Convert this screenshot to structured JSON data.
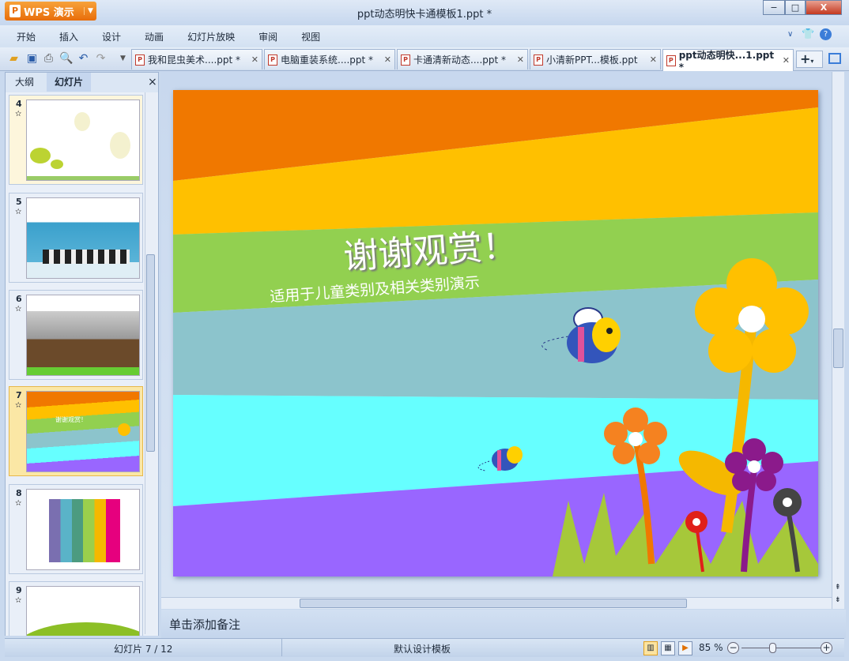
{
  "app": {
    "button_label": "WPS 演示",
    "window_title": "ppt动态明快卡通模板1.ppt *"
  },
  "window_controls": {
    "minimize": "−",
    "maximize": "□",
    "close": "X"
  },
  "menu": [
    "开始",
    "插入",
    "设计",
    "动画",
    "幻灯片放映",
    "审阅",
    "视图"
  ],
  "doc_tabs": [
    {
      "label": "我和昆虫美术....ppt *",
      "active": false
    },
    {
      "label": "电脑重装系统....ppt *",
      "active": false
    },
    {
      "label": "卡通清新动态....ppt *",
      "active": false
    },
    {
      "label": "小清新PPT...模板.ppt",
      "active": false
    },
    {
      "label": "ppt动态明快...1.ppt *",
      "active": true
    }
  ],
  "panel": {
    "tabs": [
      "大纲",
      "幻灯片"
    ],
    "active_tab": "幻灯片",
    "close": "×"
  },
  "thumbnails": [
    {
      "num": "4"
    },
    {
      "num": "5"
    },
    {
      "num": "6"
    },
    {
      "num": "7",
      "selected": true
    },
    {
      "num": "8"
    },
    {
      "num": "9"
    }
  ],
  "slide": {
    "title": "谢谢观赏！",
    "subtitle": "适用于儿童类别及相关类别演示",
    "colors": {
      "orange": "#f07800",
      "yellow": "#ffc000",
      "green": "#92d050",
      "grayblue": "#8cc4cc",
      "cyan": "#66ffff",
      "purple": "#9966ff"
    }
  },
  "notes": {
    "placeholder": "单击添加备注"
  },
  "status": {
    "slide_counter": "幻灯片 7 / 12",
    "template": "默认设计模板",
    "zoom": "85 %",
    "zoom_percent": 85
  }
}
